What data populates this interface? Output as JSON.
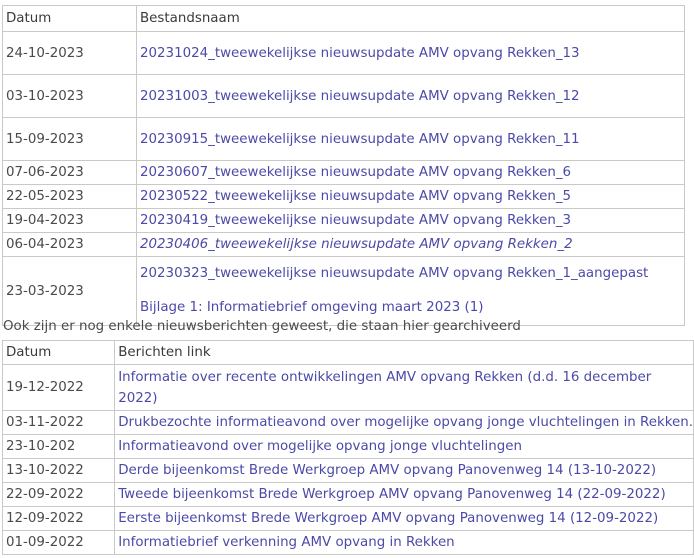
{
  "files_table": {
    "headers": [
      "Datum",
      "Bestandsnaam"
    ],
    "rows": [
      {
        "date": "24-10-2023",
        "links": [
          "20231024_tweewekelijkse nieuwsupdate AMV opvang Rekken_13"
        ]
      },
      {
        "date": "03-10-2023",
        "links": [
          "20231003_tweewekelijkse nieuwsupdate AMV opvang Rekken_12"
        ]
      },
      {
        "date": "15-09-2023",
        "links": [
          "20230915_tweewekelijkse nieuwsupdate AMV opvang Rekken_11"
        ]
      },
      {
        "date": "07-06-2023",
        "links": [
          "20230607_tweewekelijkse nieuwsupdate AMV opvang Rekken_6"
        ]
      },
      {
        "date": "22-05-2023",
        "links": [
          "20230522_tweewekelijkse nieuwsupdate AMV opvang Rekken_5"
        ]
      },
      {
        "date": "19-04-2023",
        "links": [
          "20230419_tweewekelijkse nieuwsupdate AMV opvang Rekken_3"
        ]
      },
      {
        "date": "06-04-2023",
        "links": [
          "20230406_tweewekelijkse nieuwsupdate AMV opvang Rekken_2"
        ]
      },
      {
        "date": "23-03-2023",
        "links": [
          "20230323_tweewekelijkse nieuwsupdate AMV opvang Rekken_1_aangepast",
          "Bijlage 1: Informatiebrief omgeving maart 2023 (1)"
        ]
      }
    ]
  },
  "archive_note": "Ook zijn er nog enkele nieuwsberichten geweest, die staan hier gearchiveerd",
  "news_table": {
    "headers": [
      "Datum",
      "Berichten link"
    ],
    "rows": [
      {
        "date": "19-12-2022",
        "links": [
          "Informatie over recente ontwikkelingen AMV opvang Rekken (d.d. 16 december",
          "2022)"
        ]
      },
      {
        "date": "03-11-2022",
        "links": [
          "Drukbezochte informatieavond over mogelijke opvang jonge vluchtelingen in Rekken."
        ]
      },
      {
        "date": "23-10-202",
        "links": [
          "Informatieavond over mogelijke opvang jonge vluchtelingen"
        ]
      },
      {
        "date": "13-10-2022",
        "links": [
          "Derde bijeenkomst Brede Werkgroep AMV opvang Panovenweg 14 (13-10-2022)"
        ]
      },
      {
        "date": "22-09-2022",
        "links": [
          "Tweede bijeenkomst Brede Werkgroep AMV opvang Panovenweg 14 (22-09-2022)"
        ]
      },
      {
        "date": "12-09-2022",
        "links": [
          "Eerste bijeenkomst Brede Werkgroep AMV opvang Panovenweg 14 (12-09-2022)"
        ]
      },
      {
        "date": "01-09-2022",
        "links": [
          "Informatiebrief verkenning AMV opvang in Rekken"
        ]
      }
    ]
  },
  "colors": {
    "link": "#4b4aa8",
    "text": "#4a4a4a",
    "border": "#c9c9c9"
  }
}
